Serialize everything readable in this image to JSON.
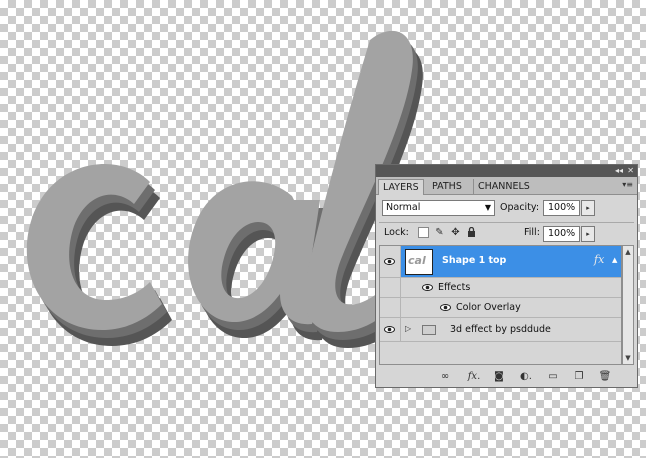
{
  "canvas": {
    "text_fill": "#a3a3a3",
    "shadow_fill": "#555555"
  },
  "panel": {
    "tabs": [
      "LAYERS",
      "PATHS",
      "CHANNELS"
    ],
    "blend_mode": "Normal",
    "opacity_label": "Opacity:",
    "opacity_value": "100%",
    "lock_label": "Lock:",
    "fill_label": "Fill:",
    "fill_value": "100%",
    "layers": [
      {
        "name": "Shape 1 top",
        "thumb_text": "cal",
        "selected": true,
        "fx": "fx"
      },
      {
        "name": "Effects"
      },
      {
        "name": "Color Overlay"
      },
      {
        "name": "3d effect by psddude"
      }
    ],
    "selection_color": "#3c8fe6",
    "footer_icons": [
      "link-icon",
      "fx-icon",
      "mask-icon",
      "adjustment-icon",
      "group-icon",
      "new-layer-icon",
      "trash-icon"
    ]
  }
}
